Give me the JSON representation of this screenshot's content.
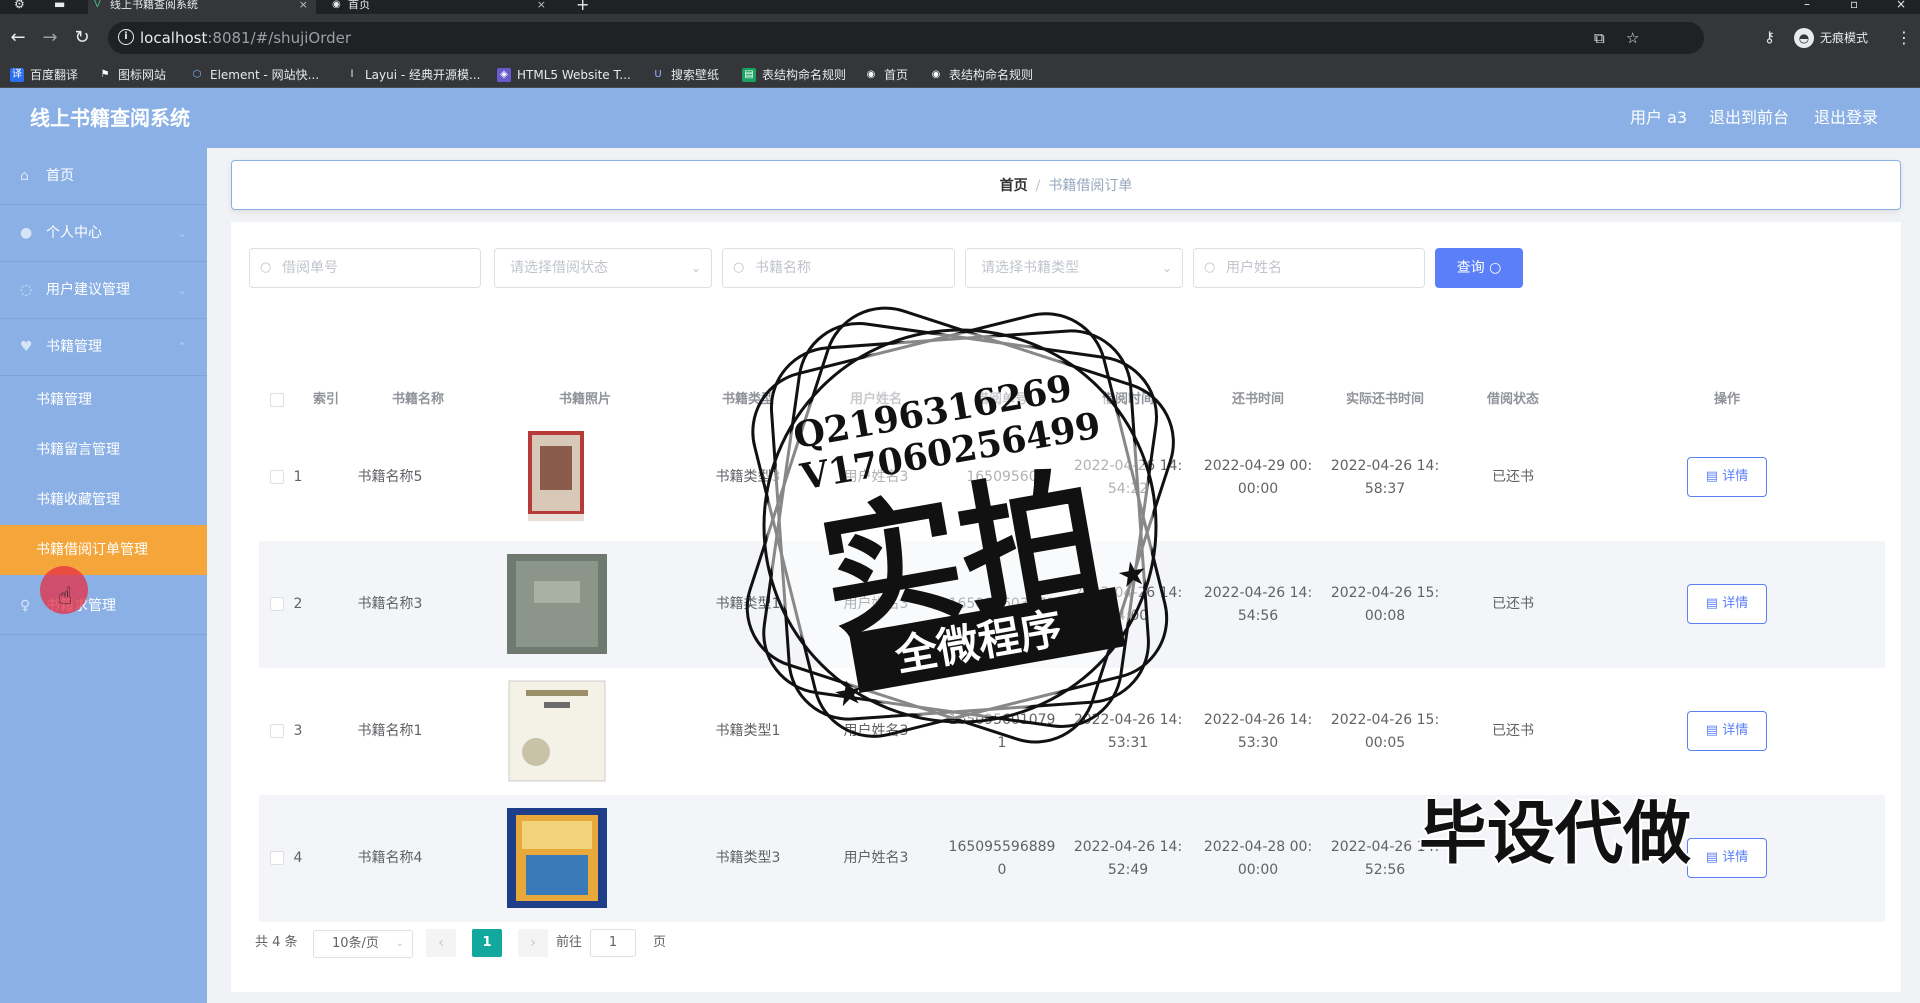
{
  "browser": {
    "tabs": [
      {
        "title": "线上书籍查阅系统",
        "icon": "vue-icon"
      },
      {
        "title": "首页",
        "icon": "globe-icon"
      }
    ],
    "url_host": "localhost",
    "url_path": ":8081/#/shujiOrder",
    "profile_label": "无痕模式",
    "bookmarks": [
      "百度翻译",
      "图标网站",
      "Element - 网站快...",
      "Layui - 经典开源模...",
      "HTML5 Website T...",
      "搜索壁纸",
      "表结构命名规则",
      "首页",
      "表结构命名规则"
    ]
  },
  "header": {
    "title": "线上书籍查阅系统",
    "user_label": "用户 a3",
    "back_label": "退出到前台",
    "logout_label": "退出登录"
  },
  "sidebar": {
    "items": [
      {
        "label": "首页",
        "icon": "home-icon"
      },
      {
        "label": "个人中心",
        "icon": "user-icon"
      },
      {
        "label": "用户建议管理",
        "icon": "message-icon"
      },
      {
        "label": "书籍管理",
        "icon": "book-icon"
      }
    ],
    "subitems": [
      "书籍管理",
      "书籍留言管理",
      "书籍收藏管理",
      "书籍借阅订单管理"
    ],
    "last_item": {
      "label": "书籍求管理",
      "icon": "bulb-icon"
    },
    "active_color": "#f5a63b",
    "bg_color": "#8ab0e6"
  },
  "breadcrumb": {
    "home": "首页",
    "current": "书籍借阅订单"
  },
  "search": {
    "order_no_placeholder": "借阅单号",
    "status_placeholder": "请选择借阅状态",
    "book_name_placeholder": "书籍名称",
    "book_type_placeholder": "请选择书籍类型",
    "user_name_placeholder": "用户姓名",
    "query_label": "查询"
  },
  "table": {
    "headers": [
      "索引",
      "书籍名称",
      "书籍照片",
      "书籍类型",
      "用户姓名",
      "借阅单号",
      "借阅时间",
      "还书时间",
      "实际还书时间",
      "借阅状态",
      "操作"
    ],
    "rows": [
      {
        "index": "1",
        "book_name": "书籍名称5",
        "book_type": "书籍类型3",
        "user_name": "用户姓名3",
        "order_no": "16509560",
        "borrow_time": "2022-04-26 14:\n54:22",
        "return_time": "2022-04-29 00:\n00:00",
        "actual_return_time": "2022-04-26 14:\n58:37",
        "status": "已还书",
        "action": "详情",
        "cover": "cover-red"
      },
      {
        "index": "2",
        "book_name": "书籍名称3",
        "book_type": "书籍类型1",
        "user_name": "用户姓名3",
        "order_no": "165095603973",
        "borrow_time": "2022-04-26 14:\n54:00",
        "return_time": "2022-04-26 14:\n54:56",
        "actual_return_time": "2022-04-26 15:\n00:08",
        "status": "已还书",
        "action": "详情",
        "cover": "cover-grey"
      },
      {
        "index": "3",
        "book_name": "书籍名称1",
        "book_type": "书籍类型1",
        "user_name": "用户姓名3",
        "order_no": "165095601079\n1",
        "borrow_time": "2022-04-26 14:\n53:31",
        "return_time": "2022-04-26 14:\n53:30",
        "actual_return_time": "2022-04-26 15:\n00:05",
        "status": "已还书",
        "action": "详情",
        "cover": "cover-white"
      },
      {
        "index": "4",
        "book_name": "书籍名称4",
        "book_type": "书籍类型3",
        "user_name": "用户姓名3",
        "order_no": "165095596889\n0",
        "borrow_time": "2022-04-26 14:\n52:49",
        "return_time": "2022-04-28 00:\n00:00",
        "actual_return_time": "2022-04-26 14:\n52:56",
        "status": "",
        "action": "详情",
        "cover": "cover-blue"
      }
    ]
  },
  "pagination": {
    "total": "共 4 条",
    "page_size": "10条/页",
    "current_page": "1",
    "goto_label": "前往",
    "goto_value": "1",
    "page_suffix": "页"
  },
  "overlay": {
    "stamp_qq": "Q2196316269",
    "stamp_v": "V17060256499",
    "stamp_main": "实拍",
    "stamp_band": "全微程序",
    "watermark": "毕设代做"
  },
  "colors": {
    "primary": "#5b7ff6",
    "header": "#8ab0e6",
    "active_menu": "#f5a63b",
    "pager_active": "#13a89e"
  }
}
